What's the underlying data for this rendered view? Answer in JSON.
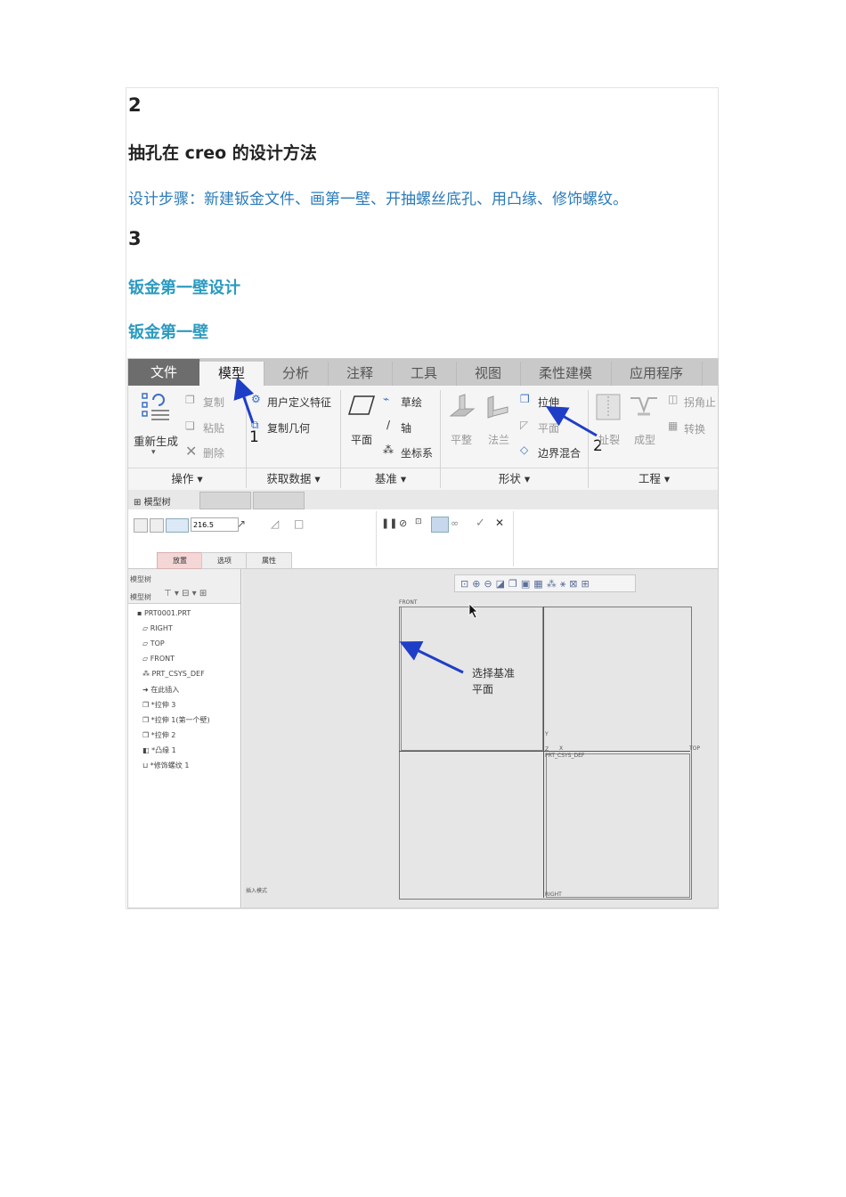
{
  "article": {
    "section2_num": "2",
    "section2_title": "抽孔在 creo 的设计方法",
    "steps_text": "设计步骤：新建钣金文件、画第一壁、开抽螺丝底孔、用凸缘、修饰螺纹。",
    "section3_num": "3",
    "section3_title": "钣金第一壁设计",
    "sub_title": "钣金第一壁"
  },
  "screenshot": {
    "tabs": [
      "文件",
      "模型",
      "分析",
      "注释",
      "工具",
      "视图",
      "柔性建模",
      "应用程序"
    ],
    "active_tab": "模型",
    "ribbon": {
      "copy": "复制",
      "paste": "粘贴",
      "delete": "删除",
      "regenerate": "重新生成",
      "user_feature": "用户定义特征",
      "copy_geometry": "复制几何",
      "sketch": "草绘",
      "axis": "轴",
      "plane": "平面",
      "csys": "坐标系",
      "extrude": "拉伸",
      "flat": "平整",
      "flange": "法兰",
      "plane2": "平面",
      "boundary_blend": "边界混合",
      "corner_relief": "拐角止",
      "convert": "转换",
      "rip": "扯裂",
      "form": "成型",
      "group_operations": "操作",
      "group_get_data": "获取数据",
      "group_datum": "基准",
      "group_shapes": "形状",
      "group_engineering": "工程"
    },
    "markers": {
      "one": "1",
      "two": "2"
    },
    "panel_tab": "模型树",
    "dash": {
      "depth_value": "216.5",
      "sub_tabs": [
        "放置",
        "选项",
        "属性"
      ]
    },
    "tree_header": "模型树",
    "tree_tab": "模型树",
    "tree_items": [
      "PRT0001.PRT",
      "RIGHT",
      "TOP",
      "FRONT",
      "PRT_CSYS_DEF",
      "在此插入",
      "*拉伸 3",
      "*拉伸 1(第一个壁)",
      "*拉伸 2",
      "*凸缘 1",
      "*修饰螺纹 1"
    ],
    "viewport": {
      "front": "FRONT",
      "top": "TOP",
      "right": "RIGHT",
      "csys": "PRT_CSYS_DEF",
      "axis_y": "Y",
      "axis_z": "Z",
      "axis_x": "X",
      "status": "插入模式",
      "annotation_line1": "选择基准",
      "annotation_line2": "平面"
    },
    "colors": {
      "arrow": "#1f3ec8",
      "tab_bar": "#c9c9c9",
      "file_tab": "#6d6d6d",
      "viewport": "#e6e6e6"
    }
  }
}
